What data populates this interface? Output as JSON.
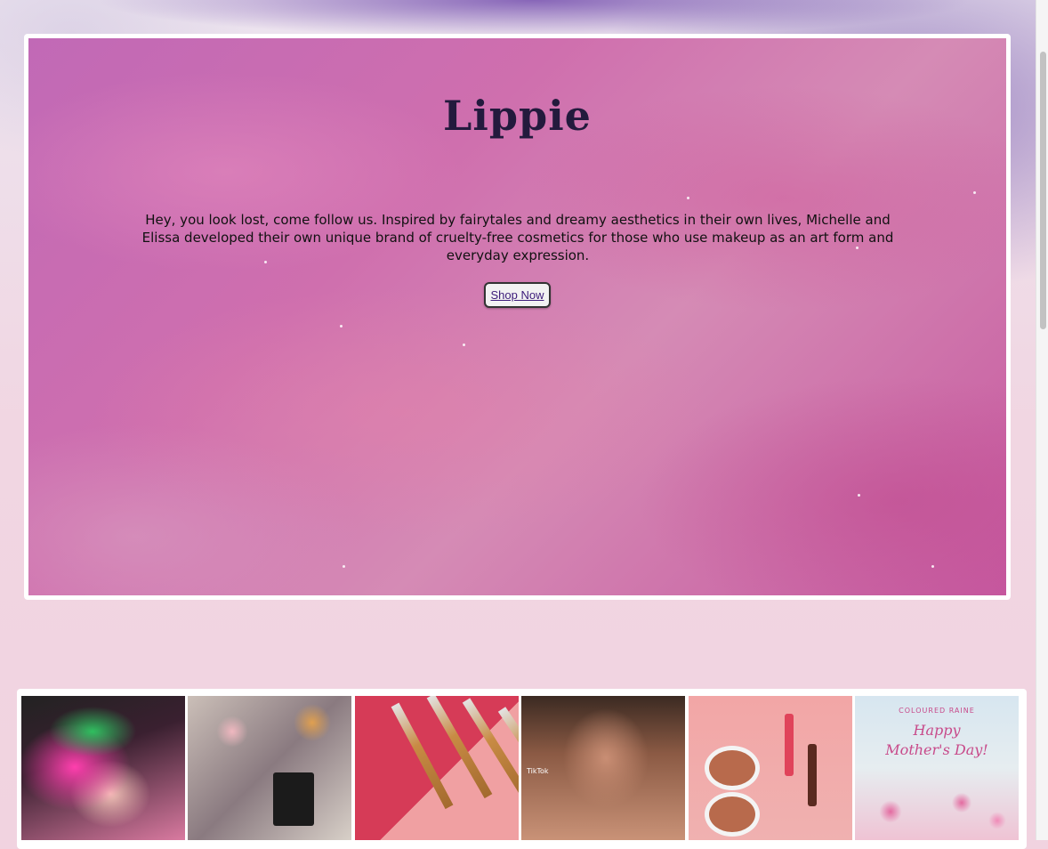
{
  "hero": {
    "title": "Lippie",
    "description": "Hey, you look lost, come follow us. Inspired by fairytales and dreamy aesthetics in their own lives, Michelle and Elissa developed their own unique brand of cruelty-free cosmetics for those who use makeup as an art form and everyday expression.",
    "cta_label": "Shop Now"
  },
  "gallery": {
    "tiles": [
      {
        "icon": "pink-eye-makeup-photo"
      },
      {
        "icon": "cosmetics-flatlay-photo"
      },
      {
        "icon": "makeup-brushes-photo"
      },
      {
        "icon": "eyeshadow-tutorial-photo",
        "overlay": "TikTok"
      },
      {
        "icon": "compact-and-lip-gloss-photo"
      },
      {
        "icon": "mothers-day-flowers-photo",
        "brand": "COLOURED RAINE",
        "caption_line1": "Happy",
        "caption_line2": "Mother's Day!"
      }
    ]
  },
  "colors": {
    "page_background": "#f1d3e0",
    "hero_background": "#c96aa9",
    "title_color": "#231a3d",
    "link_color": "#3c1b7a"
  }
}
